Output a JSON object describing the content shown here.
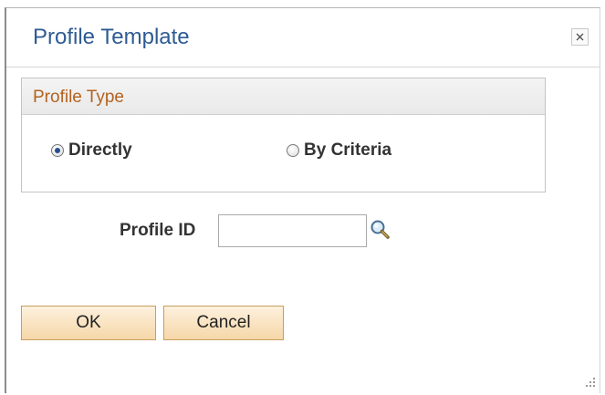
{
  "dialog": {
    "title": "Profile Template",
    "close_icon": "close-icon"
  },
  "profile_type": {
    "title": "Profile Type",
    "options": [
      {
        "label": "Directly",
        "checked": true
      },
      {
        "label": "By Criteria",
        "checked": false
      }
    ]
  },
  "profile_id": {
    "label": "Profile ID",
    "value": "",
    "lookup_icon": "magnifier-lookup-icon"
  },
  "buttons": {
    "ok_label": "OK",
    "cancel_label": "Cancel"
  },
  "colors": {
    "title": "#2f5b93",
    "group_title": "#b3631f",
    "button_fill": "#f6d7a8",
    "button_border": "#c79e5e"
  }
}
